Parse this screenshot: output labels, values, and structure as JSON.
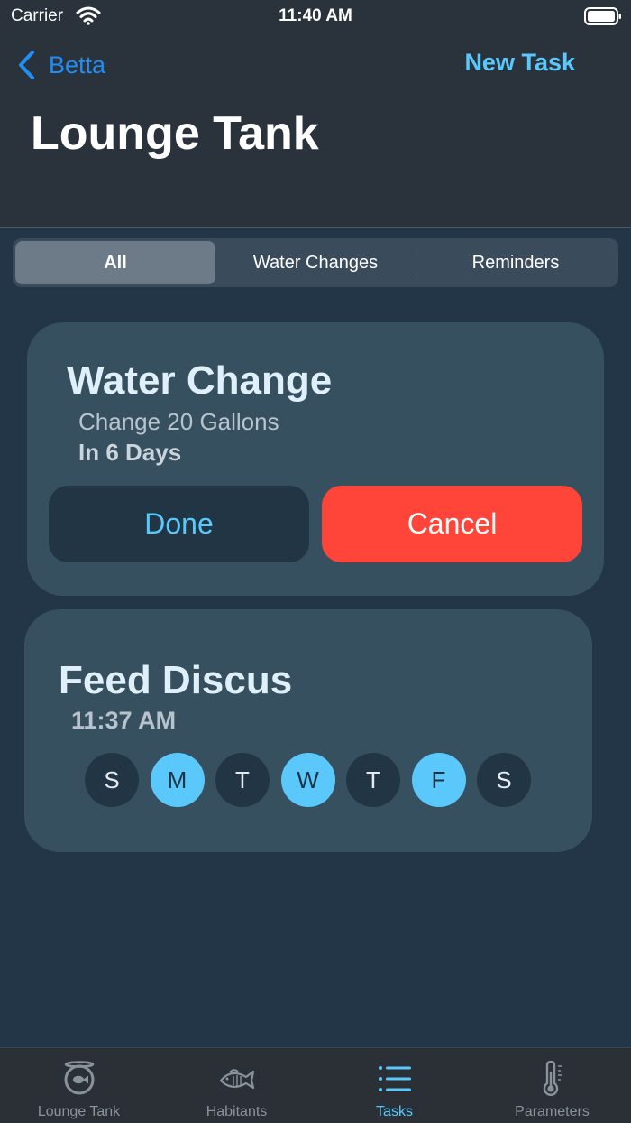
{
  "status": {
    "carrier": "Carrier",
    "time": "11:40 AM"
  },
  "nav": {
    "back_label": "Betta",
    "action_label": "New Task",
    "title": "Lounge Tank"
  },
  "segments": [
    "All",
    "Water Changes",
    "Reminders"
  ],
  "water_change": {
    "title": "Water Change",
    "subtitle": "Change 20 Gallons",
    "due": "In 6 Days",
    "done_label": "Done",
    "cancel_label": "Cancel"
  },
  "feed": {
    "title": "Feed Discus",
    "time": "11:37 AM",
    "days": [
      {
        "label": "S",
        "on": false
      },
      {
        "label": "M",
        "on": true
      },
      {
        "label": "T",
        "on": false
      },
      {
        "label": "W",
        "on": true
      },
      {
        "label": "T",
        "on": false
      },
      {
        "label": "F",
        "on": true
      },
      {
        "label": "S",
        "on": false
      }
    ]
  },
  "tabs": [
    {
      "label": "Lounge Tank",
      "icon": "tank-icon"
    },
    {
      "label": "Habitants",
      "icon": "fish-icon"
    },
    {
      "label": "Tasks",
      "icon": "list-icon"
    },
    {
      "label": "Parameters",
      "icon": "thermometer-icon"
    }
  ],
  "colors": {
    "accent": "#5ac8fa",
    "link": "#1f8ef7",
    "danger": "#ff453a",
    "card": "#37505f",
    "background": "#233648"
  }
}
